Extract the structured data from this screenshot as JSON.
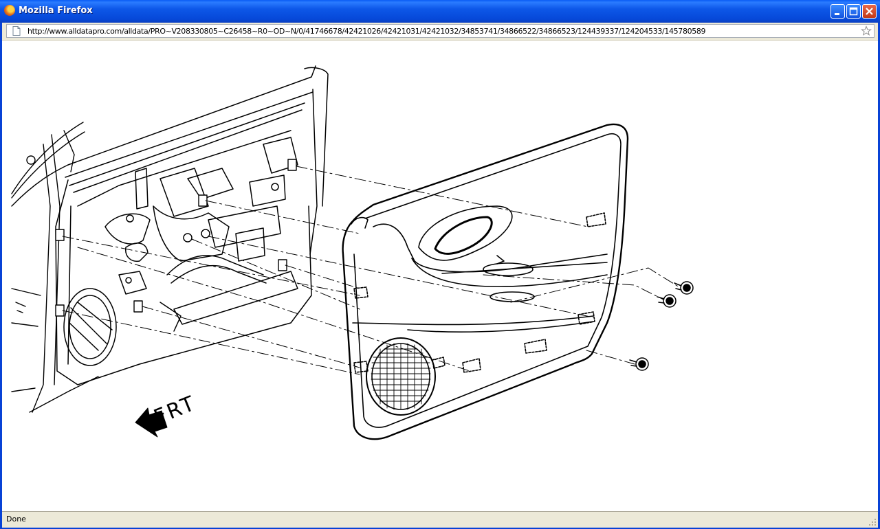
{
  "window": {
    "title": "Mozilla Firefox",
    "icon": "firefox-icon",
    "controls": [
      "minimize-icon",
      "maximize-icon",
      "close-icon"
    ]
  },
  "addressbar": {
    "url": "http://www.alldatapro.com/alldata/PRO~V208330805~C26458~R0~OD~N/0/41746678/42421026/42421031/42421032/34853741/34866522/34866523/124439337/124204533/145780589"
  },
  "diagram": {
    "direction_label": "FRT"
  },
  "statusbar": {
    "text": "Done"
  }
}
